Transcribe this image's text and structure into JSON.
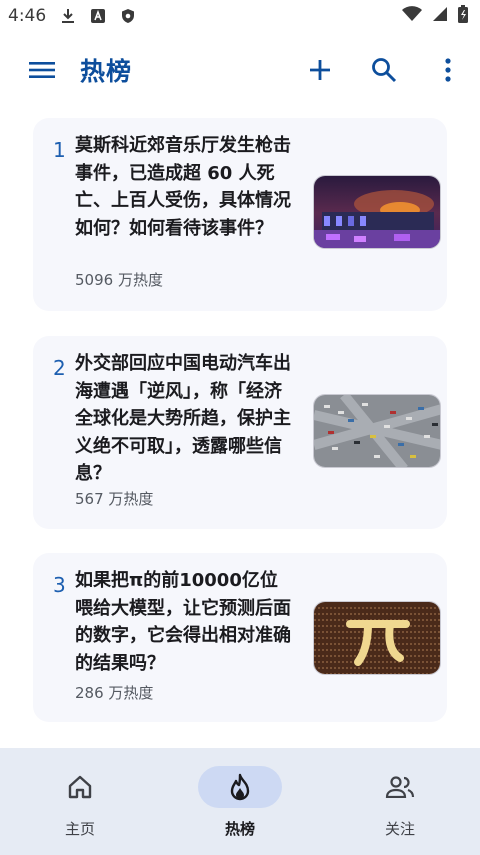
{
  "status_bar": {
    "time": "4:46",
    "left_icons": [
      "download-icon",
      "app-a-icon",
      "shield-icon"
    ],
    "right_icons": [
      "wifi-icon",
      "signal-icon",
      "battery-icon"
    ]
  },
  "app_bar": {
    "title": "热榜",
    "accent_color": "#0d4e9c"
  },
  "hot_list": [
    {
      "rank": "1",
      "question": "莫斯科近郊音乐厅发生枪击事件，已造成超 60 人死亡、上百人受伤，具体情况如何？如何看待该事件？",
      "heat": "5096 万热度",
      "thumb": "concert-hall-fire-image"
    },
    {
      "rank": "2",
      "question": "外交部回应中国电动汽车出海遭遇「逆风」，称「经济全球化是大势所趋，保护主义绝不可取」，透露哪些信息？",
      "heat": "567 万热度",
      "thumb": "car-parking-aerial-image"
    },
    {
      "rank": "3",
      "question": "如果把π的前10000亿位喂给大模型，让它预测后面的数字，它会得出相对准确的结果吗？",
      "heat": "286 万热度",
      "thumb": "pi-symbol-image"
    }
  ],
  "bottom_nav": {
    "items": [
      {
        "label": "主页",
        "icon": "home-icon",
        "active": false
      },
      {
        "label": "热榜",
        "icon": "fire-icon",
        "active": true
      },
      {
        "label": "关注",
        "icon": "people-icon",
        "active": false
      }
    ]
  }
}
